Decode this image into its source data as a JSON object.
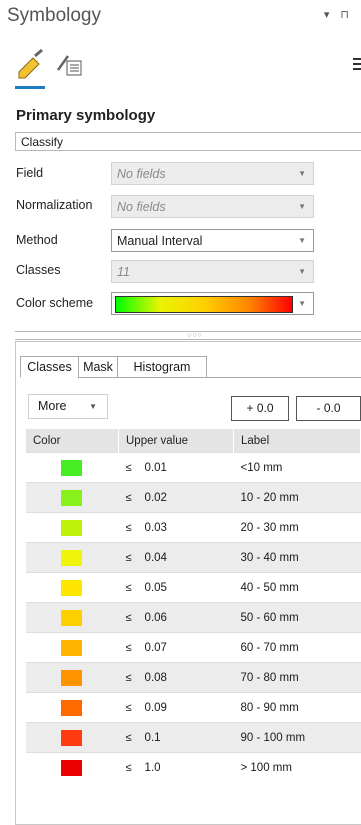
{
  "pane": {
    "title": "Symbology",
    "pin_glyphs": "▾ ⊓"
  },
  "tabs_icons": [
    "primary-symbology-icon",
    "secondary-symbology-icon"
  ],
  "section_title": "Primary symbology",
  "renderer": "Classify",
  "fields": [
    {
      "label": "Field",
      "value": "No fields"
    },
    {
      "label": "Normalization",
      "value": "No fields"
    },
    {
      "label": "Method",
      "value": "Manual Interval"
    },
    {
      "label": "Classes",
      "value": "11"
    },
    {
      "label": "Color scheme",
      "value": ""
    }
  ],
  "color_scheme": {
    "stops": [
      "#00ff00",
      "#e9f400",
      "#ffd000",
      "#ff8800",
      "#ff0000"
    ]
  },
  "sub_tabs": [
    "Classes",
    "Mask",
    "Histogram"
  ],
  "more_label": "More",
  "plus_label": "+ 0.0",
  "minus_label": "- 0.0",
  "table": {
    "headers": [
      "Color",
      "Upper value",
      "Label"
    ],
    "le_symbol": "≤",
    "rows": [
      {
        "color": "#44ee22",
        "upper": "0.01",
        "label": "<10 mm"
      },
      {
        "color": "#88f01a",
        "upper": "0.02",
        "label": "10 - 20 mm"
      },
      {
        "color": "#bef20c",
        "upper": "0.03",
        "label": "20 - 30 mm"
      },
      {
        "color": "#f0f40a",
        "upper": "0.04",
        "label": "30 - 40 mm"
      },
      {
        "color": "#ffe600",
        "upper": "0.05",
        "label": "40 - 50 mm"
      },
      {
        "color": "#ffd000",
        "upper": "0.06",
        "label": "50 - 60 mm"
      },
      {
        "color": "#ffb400",
        "upper": "0.07",
        "label": "60 - 70 mm"
      },
      {
        "color": "#ff9400",
        "upper": "0.08",
        "label": "70 - 80 mm"
      },
      {
        "color": "#ff6a00",
        "upper": "0.09",
        "label": "80 - 90 mm"
      },
      {
        "color": "#ff3a10",
        "upper": "0.1",
        "label": "90 - 100 mm"
      },
      {
        "color": "#ee0000",
        "upper": "1.0",
        "label": "> 100 mm"
      }
    ]
  }
}
